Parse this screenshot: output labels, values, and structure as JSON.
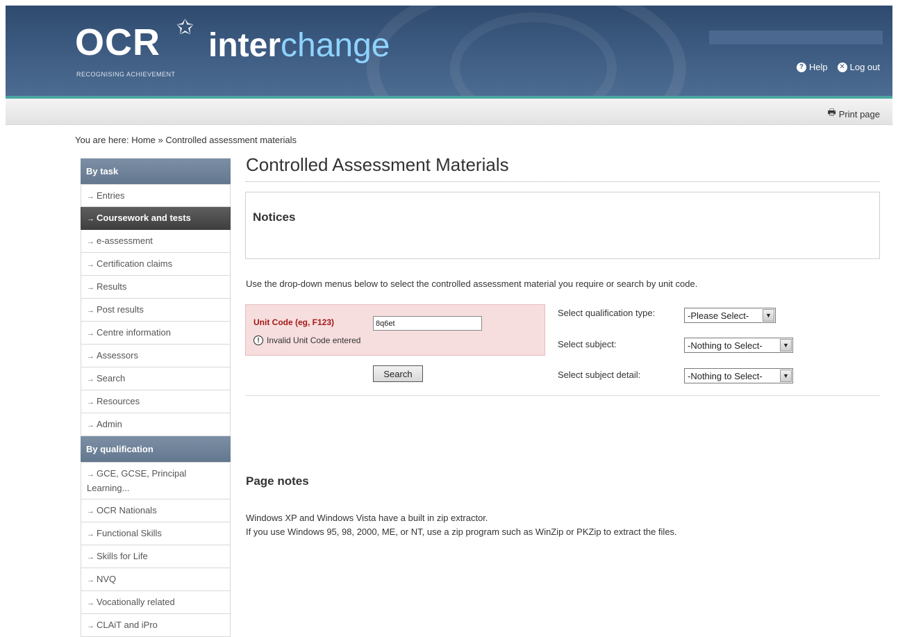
{
  "header": {
    "logo_brand": "OCR",
    "logo_tagline": "RECOGNISING ACHIEVEMENT",
    "logo_product_a": "inter",
    "logo_product_b": "change",
    "help_label": "Help",
    "logout_label": "Log out",
    "print_label": "Print page"
  },
  "breadcrumb": {
    "prefix": "You are here:",
    "home": "Home",
    "separator": "»",
    "current": "Controlled assessment materials"
  },
  "sidebar": {
    "by_task_heading": "By task",
    "task_items": [
      "Entries",
      "Coursework and tests",
      "e-assessment",
      "Certification claims",
      "Results",
      "Post results",
      "Centre information",
      "Assessors",
      "Search",
      "Resources",
      "Admin"
    ],
    "by_qualification_heading": "By qualification",
    "qualification_items": [
      "GCE, GCSE, Principal Learning...",
      "OCR Nationals",
      "Functional Skills",
      "Skills for Life",
      "NVQ",
      "Vocationally related",
      "CLAiT and iPro"
    ]
  },
  "main": {
    "title": "Controlled Assessment Materials",
    "notices_heading": "Notices",
    "intro": "Use the drop-down menus below to select the controlled assessment material you require or search by unit code.",
    "unit_code": {
      "label": "Unit Code (eg, F123)",
      "value": "8q6et",
      "error": "Invalid Unit Code entered",
      "search_label": "Search"
    },
    "selects": {
      "qualification_label": "Select qualification type:",
      "qualification_value": "-Please Select-",
      "subject_label": "Select subject:",
      "subject_value": "-Nothing to Select-",
      "detail_label": "Select subject detail:",
      "detail_value": "-Nothing to Select-"
    },
    "page_notes": {
      "heading": "Page notes",
      "line1": "Windows XP and Windows Vista have a built in zip extractor.",
      "line2": "If you use Windows 95, 98, 2000, ME, or NT, use a zip program such as WinZip or PKZip to extract the files."
    }
  }
}
